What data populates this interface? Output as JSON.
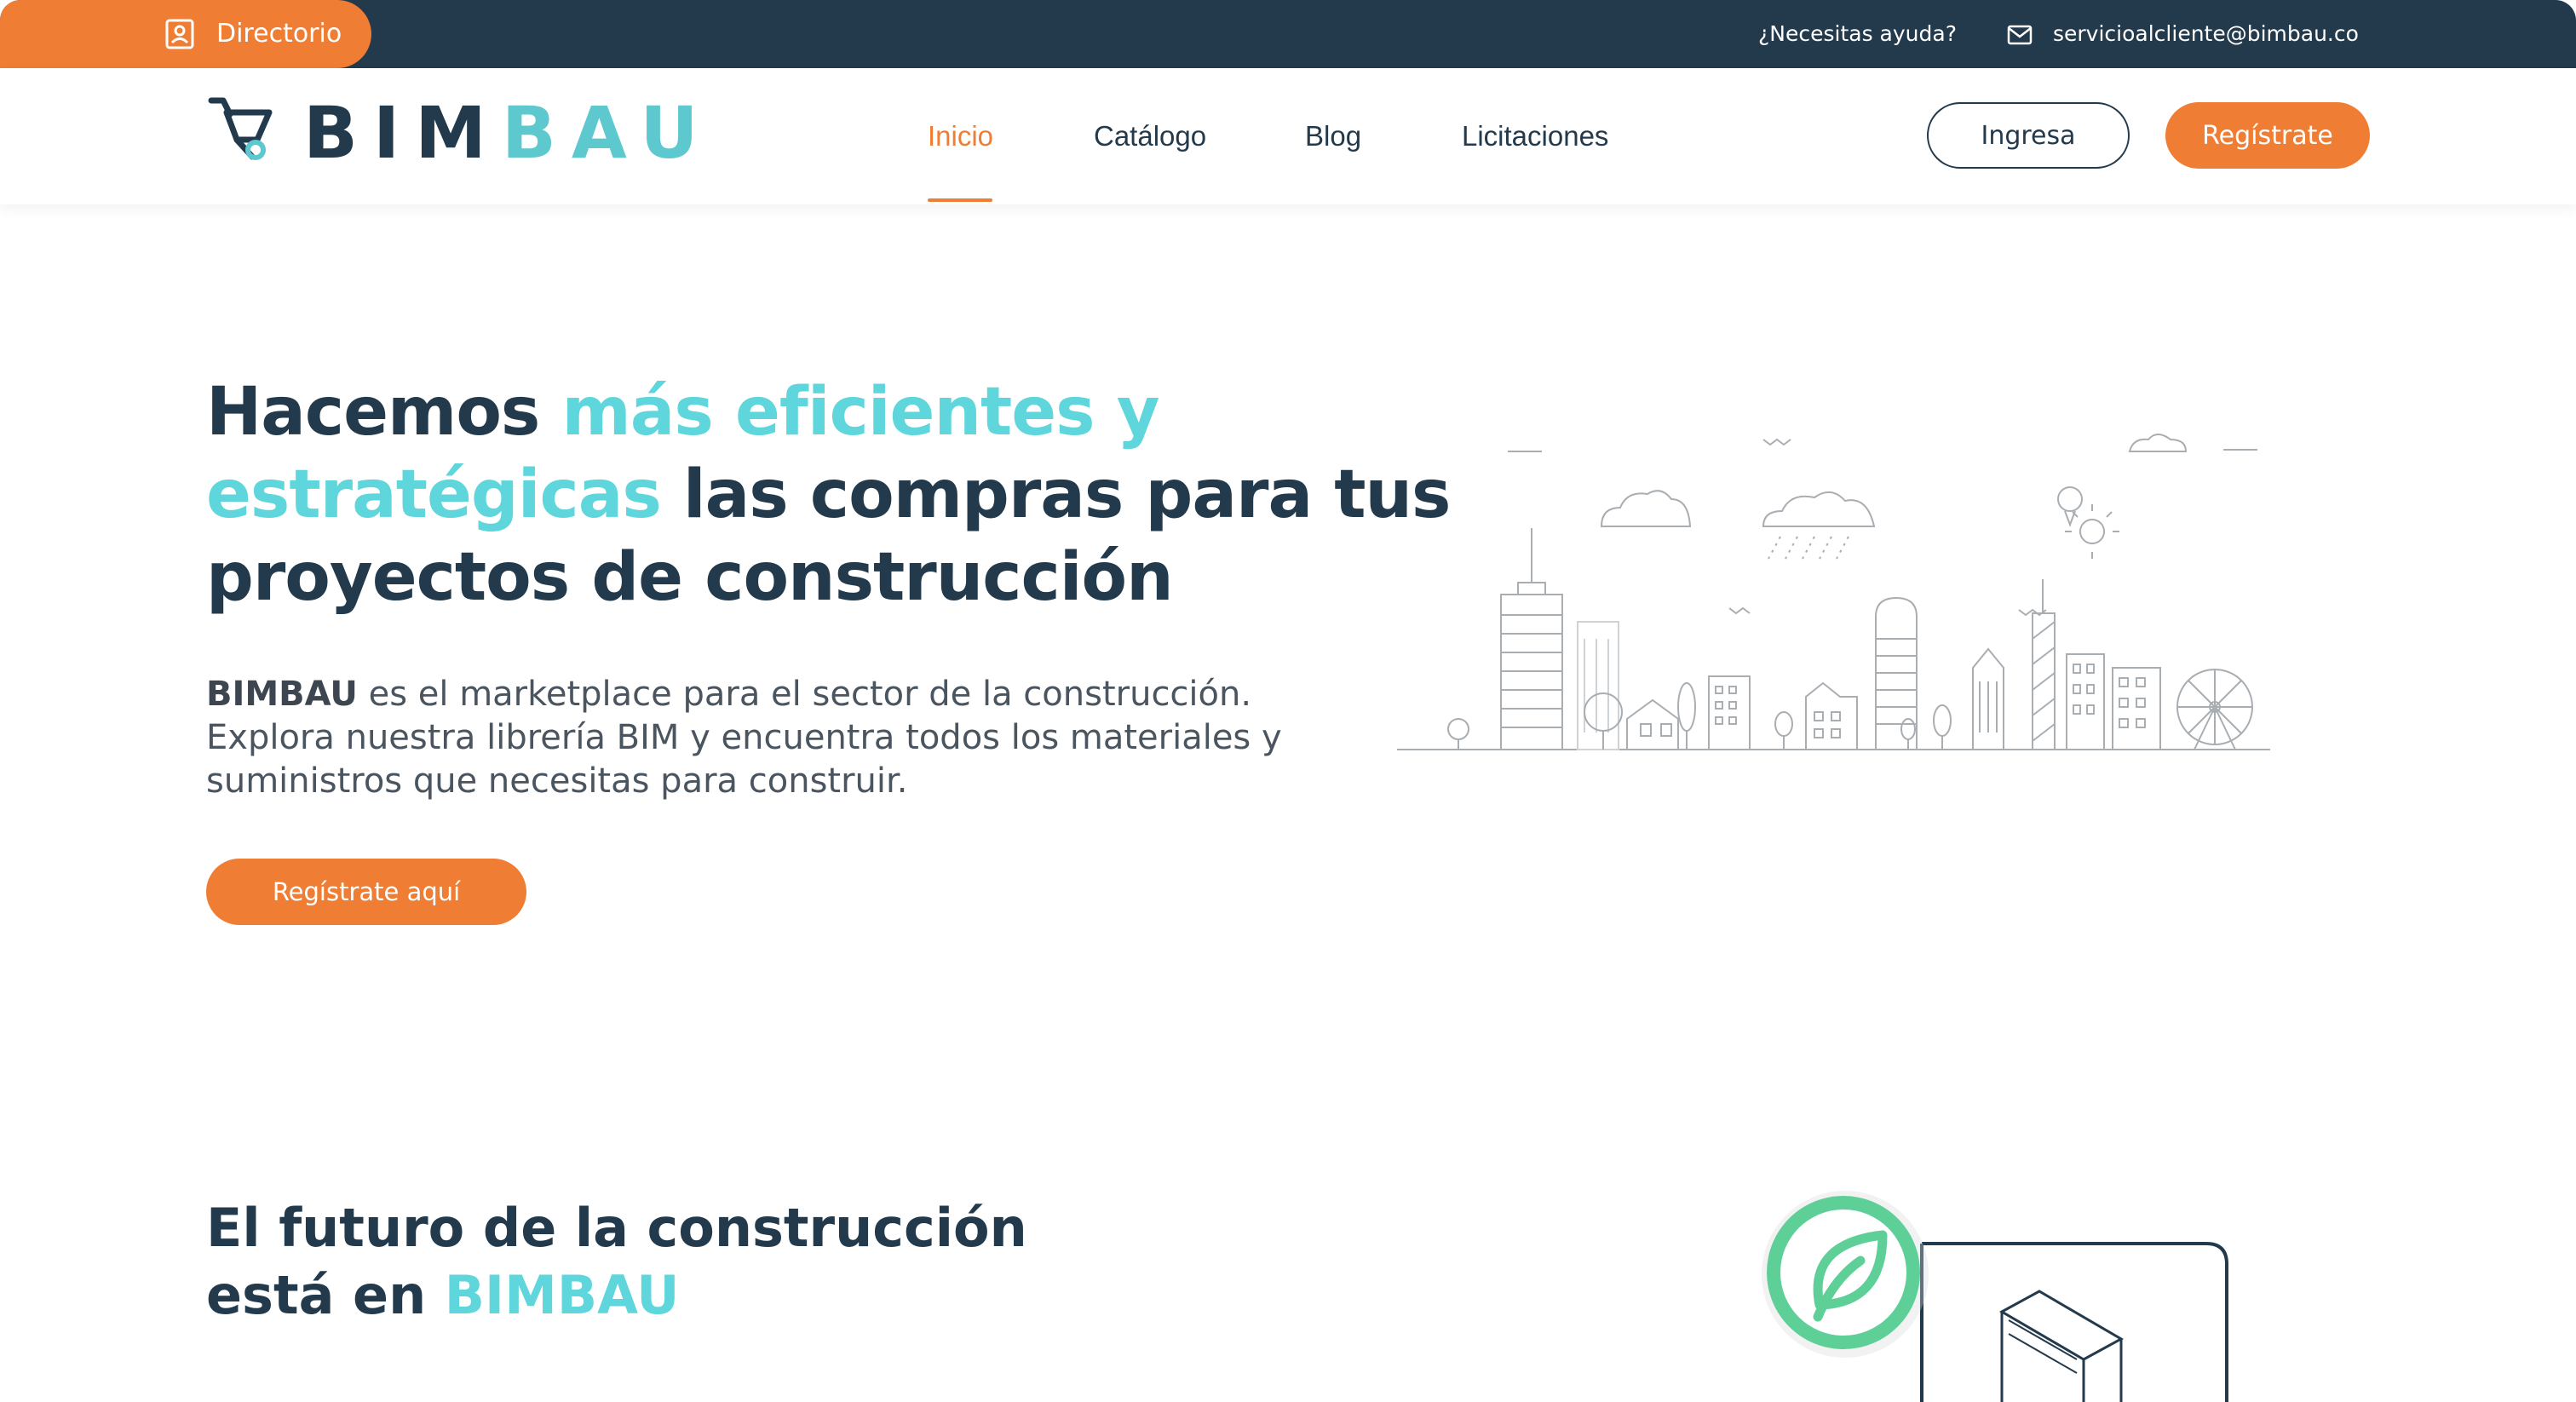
{
  "topbar": {
    "directory_label": "Directorio",
    "help_text": "¿Necesitas ayuda?",
    "email": "servicioalcliente@bimbau.co"
  },
  "header": {
    "logo_part1": "BIM",
    "logo_part2": "BAU",
    "nav": {
      "inicio": "Inicio",
      "catalogo": "Catálogo",
      "blog": "Blog",
      "licitaciones": "Licitaciones"
    },
    "active_nav": "Inicio",
    "login_label": "Ingresa",
    "register_label": "Regístrate"
  },
  "hero": {
    "title_part1": "Hacemos ",
    "title_highlight": "más eficientes y estratégicas",
    "title_part2": " las compras para tus proyectos de construcción",
    "desc_brand": "BIMBAU",
    "desc_text": " es el marketplace para el sector de la construcción. Explora nuestra librería BIM y encuentra todos los materiales y suministros que necesitas para construir.",
    "cta_label": "Regístrate aquí"
  },
  "section2": {
    "title_line1": "El futuro de la construcción",
    "title_line2_prefix": "está en ",
    "title_line2_highlight": "BIMBAU"
  },
  "colors": {
    "navy": "#233a4d",
    "orange": "#ef7d33",
    "teal": "#5ed6dc",
    "green": "#5fcf98"
  }
}
